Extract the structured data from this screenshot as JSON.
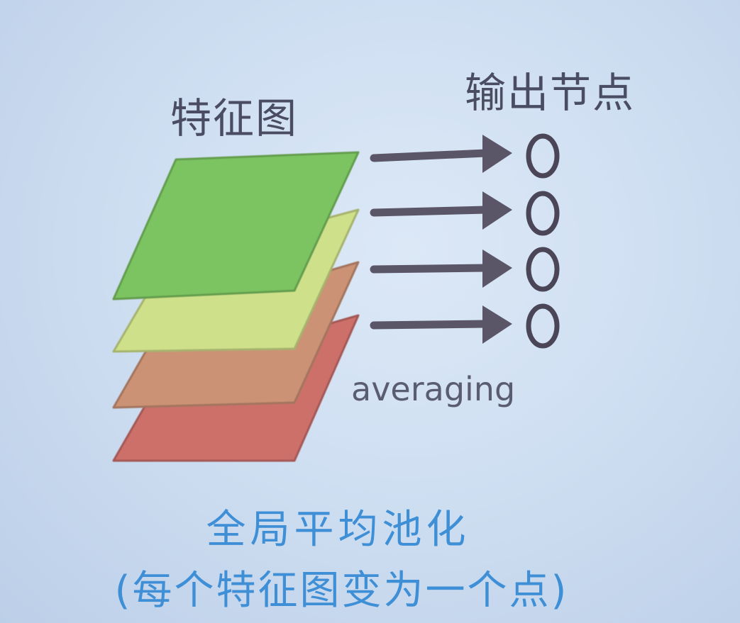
{
  "titles": {
    "feature_maps": "特征图",
    "output_nodes": "输出节点"
  },
  "operation": {
    "label": "averaging"
  },
  "caption": {
    "main": "全局平均池化",
    "sub": "(每个特征图变为一个点)"
  },
  "feature_maps": [
    {
      "name": "map-1",
      "color": "#7cc462"
    },
    {
      "name": "map-2",
      "color": "#cfe08a"
    },
    {
      "name": "map-3",
      "color": "#cc9275"
    },
    {
      "name": "map-4",
      "color": "#cd6f6b"
    }
  ],
  "arrow_color": "#5b5667",
  "node_color": "#4a4658"
}
